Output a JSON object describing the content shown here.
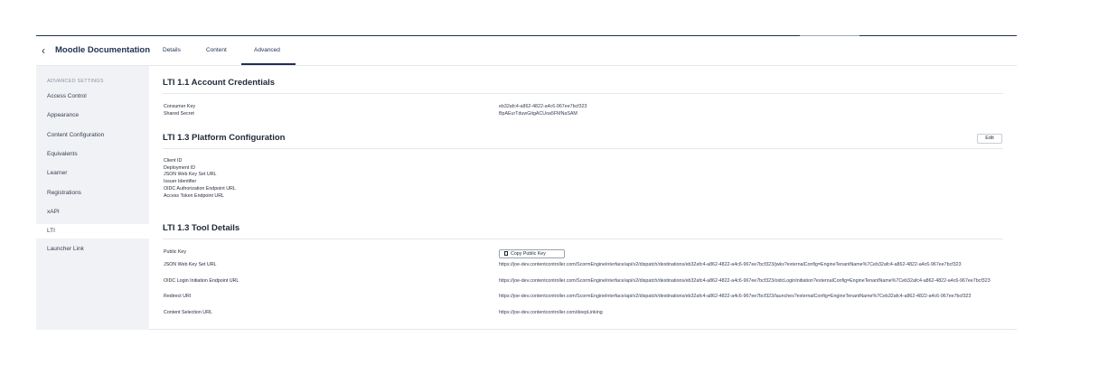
{
  "header": {
    "back_icon": "chevron-left-icon",
    "course_title": "Moodle Documentation",
    "tabs": [
      {
        "label": "Details"
      },
      {
        "label": "Content"
      },
      {
        "label": "Advanced"
      }
    ]
  },
  "sidebar": {
    "heading": "ADVANCED SETTINGS",
    "items": [
      {
        "label": "Access Control"
      },
      {
        "label": "Appearance"
      },
      {
        "label": "Content Configuration"
      },
      {
        "label": "Equivalents"
      },
      {
        "label": "Learner"
      },
      {
        "label": "Registrations"
      },
      {
        "label": "xAPI"
      },
      {
        "label": "LTI"
      },
      {
        "label": "Launcher Link"
      }
    ]
  },
  "lti11": {
    "title": "LTI 1.1 Account Credentials",
    "consumer_key_label": "Consumer Key",
    "consumer_key_value": "eb32afc4-a862-4822-a4c6-967ee7bcf323",
    "shared_secret_label": "Shared Secret",
    "shared_secret_value": "BpAEurTduwGitgACUoa5FMNaSAM"
  },
  "lti13_platform": {
    "title": "LTI 1.3 Platform Configuration",
    "edit_label": "Edit",
    "fields": [
      {
        "label": "Client ID"
      },
      {
        "label": "Deployment ID"
      },
      {
        "label": "JSON Web Key Set URL"
      },
      {
        "label": "Issuer Identifier"
      },
      {
        "label": "OIDC Authorization Endpoint URL"
      },
      {
        "label": "Access Token Endpoint URL"
      }
    ]
  },
  "lti13_tool": {
    "title": "LTI 1.3 Tool Details",
    "public_key_label": "Public Key",
    "copy_button_label": "Copy Public Key",
    "copy_icon": "copy-icon",
    "jwks_label": "JSON Web Key Set URL",
    "jwks_value": "https://joe-dev.contentcontroller.com/ScormEngineInterface/api/v2/dispatch/destinations/eb32afc4-a862-4822-a4c6-967ee7bcf323/jwks?externalConfig=EngineTenantName%7Ceb32afc4-a862-4822-a4c6-967ee7bcf323",
    "oidc_label": "OIDC Login Initiation Endpoint URL",
    "oidc_value": "https://joe-dev.contentcontroller.com/ScormEngineInterface/api/v2/dispatch/destinations/eb32afc4-a862-4822-a4c6-967ee7bcf323/oidcLoginInitiation?externalConfig=EngineTenantName%7Ceb32afc4-a862-4822-a4c6-967ee7bcf323",
    "redirect_label": "Redirect URI",
    "redirect_value": "https://joe-dev.contentcontroller.com/ScormEngineInterface/api/v2/dispatch/destinations/eb32afc4-a862-4822-a4c6-967ee7bcf323/launches?externalConfig=EngineTenantName%7Ceb32afc4-a862-4822-a4c6-967ee7bcf323",
    "content_selection_label": "Content Selection URL",
    "content_selection_value": "https://joe-dev.contentcontroller.com/deepLinking"
  }
}
